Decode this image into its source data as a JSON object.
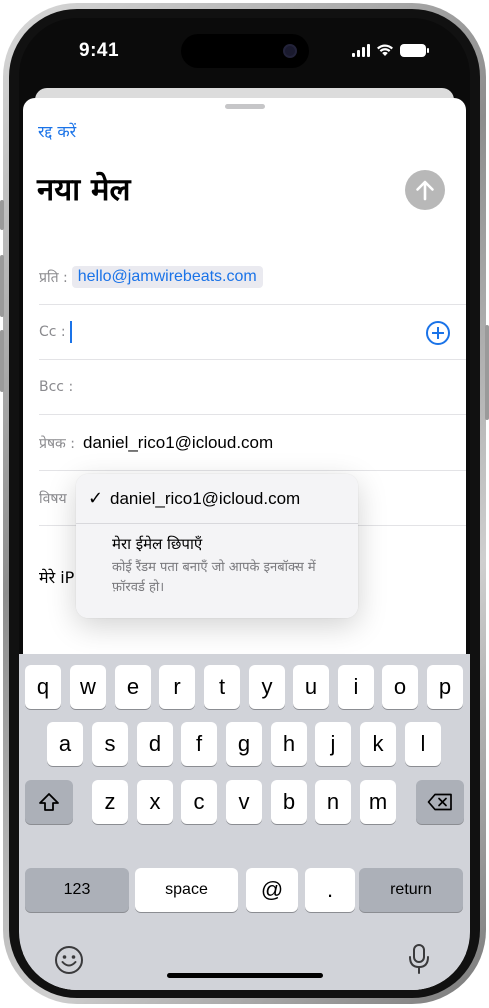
{
  "status_bar": {
    "time": "9:41"
  },
  "compose": {
    "cancel_label": "रद्द करें",
    "title": "नया मेल",
    "to_label": "प्रति :",
    "to_value": "hello@jamwirebeats.com",
    "cc_label": "Cc :",
    "bcc_label": "Bcc :",
    "from_label": "प्रेषक :",
    "from_value": "daniel_rico1@icloud.com",
    "subject_label": "विषय",
    "body_preview": "मेरे iP"
  },
  "from_menu": {
    "selected_email": "daniel_rico1@icloud.com",
    "hide_title": "मेरा ईमेल छिपाएँ",
    "hide_description": "कोई रैंडम पता बनाएँ जो आपके इनबॉक्स में फ़ॉरवर्ड हो।"
  },
  "keyboard": {
    "row1": [
      "q",
      "w",
      "e",
      "r",
      "t",
      "y",
      "u",
      "i",
      "o",
      "p"
    ],
    "row2": [
      "a",
      "s",
      "d",
      "f",
      "g",
      "h",
      "j",
      "k",
      "l"
    ],
    "row3": [
      "z",
      "x",
      "c",
      "v",
      "b",
      "n",
      "m"
    ],
    "numbers_label": "123",
    "space_label": "space",
    "at_label": "@",
    "dot_label": ".",
    "return_label": "return"
  },
  "colors": {
    "accent": "#1a73e8",
    "send_disabled": "#b8b8b8",
    "keyboard_bg": "#d1d3d9"
  }
}
